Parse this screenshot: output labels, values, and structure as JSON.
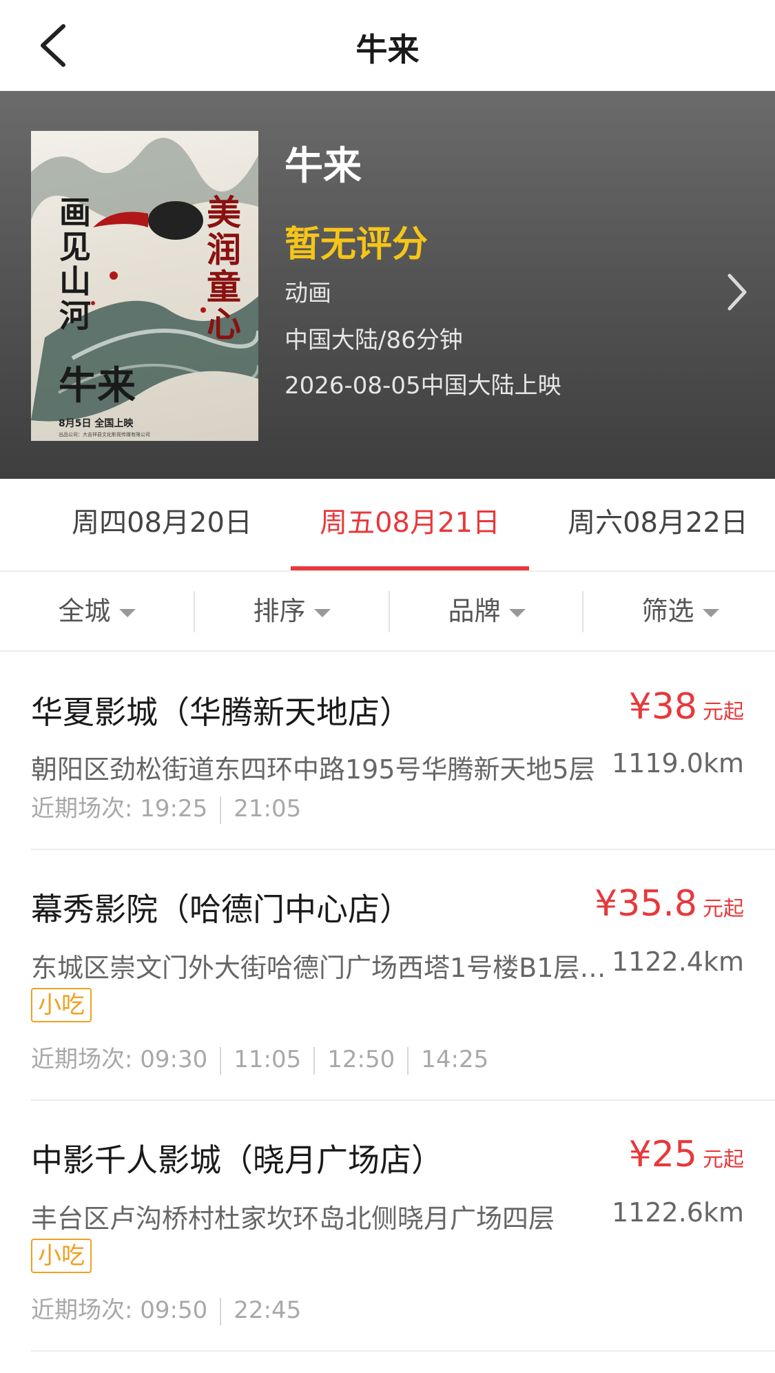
{
  "nav": {
    "title": "牛来"
  },
  "movie": {
    "title": "牛来",
    "rating": "暂无评分",
    "genre": "动画",
    "region_duration": "中国大陆/86分钟",
    "release": "2026-08-05中国大陆上映",
    "poster": {
      "left_text": "画见山河",
      "right_text": "美润童心",
      "title": "牛来",
      "date": "8月5日   全国上映",
      "tiny": "出品公司：大吉祥县文化影视传媒有限公司"
    }
  },
  "date_tabs": [
    {
      "label": "周四08月20日",
      "active": false
    },
    {
      "label": "周五08月21日",
      "active": true
    },
    {
      "label": "周六08月22日",
      "active": false
    }
  ],
  "filters": [
    {
      "label": "全城"
    },
    {
      "label": "排序"
    },
    {
      "label": "品牌"
    },
    {
      "label": "筛选"
    }
  ],
  "cinemas": [
    {
      "name": "华夏影城（华腾新天地店）",
      "price": "¥38",
      "price_unit": "元起",
      "address": "朝阳区劲松街道东四环中路195号华腾新天地5层",
      "distance": "1119.0km",
      "tag": "",
      "times_label": "近期场次: ",
      "times": [
        "19:25",
        "21:05"
      ]
    },
    {
      "name": "幕秀影院（哈德门中心店）",
      "price": "¥35.8",
      "price_unit": "元起",
      "address": "东城区崇文门外大街哈德门广场西塔1号楼B1层1…",
      "distance": "1122.4km",
      "tag": "小吃",
      "times_label": "近期场次: ",
      "times": [
        "09:30",
        "11:05",
        "12:50",
        "14:25"
      ]
    },
    {
      "name": "中影千人影城（晓月广场店）",
      "price": "¥25",
      "price_unit": "元起",
      "address": "丰台区卢沟桥村杜家坎环岛北侧晓月广场四层",
      "distance": "1122.6km",
      "tag": "小吃",
      "times_label": "近期场次: ",
      "times": [
        "09:50",
        "22:45"
      ]
    }
  ],
  "colors": {
    "accent": "#e8383b",
    "rating": "#f5c518",
    "tag": "#f0a020"
  }
}
